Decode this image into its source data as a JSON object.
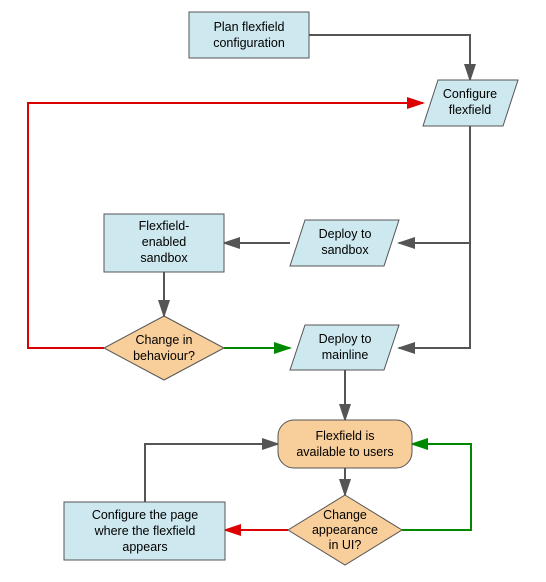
{
  "chart_data": {
    "type": "flowchart",
    "nodes": [
      {
        "id": "plan",
        "type": "process",
        "label_lines": [
          "Plan flexfield",
          "configuration"
        ]
      },
      {
        "id": "configure",
        "type": "io",
        "label_lines": [
          "Configure",
          "flexfield"
        ]
      },
      {
        "id": "deploy_sb",
        "type": "io",
        "label_lines": [
          "Deploy to",
          "sandbox"
        ]
      },
      {
        "id": "sandbox",
        "type": "process",
        "label_lines": [
          "Flexfield-",
          "enabled",
          "sandbox"
        ]
      },
      {
        "id": "decision1",
        "type": "decision",
        "label_lines": [
          "Change in",
          "behaviour?"
        ]
      },
      {
        "id": "deploy_ml",
        "type": "io",
        "label_lines": [
          "Deploy to",
          "mainline"
        ]
      },
      {
        "id": "available",
        "type": "terminator",
        "label_lines": [
          "Flexfield is",
          "available to users"
        ]
      },
      {
        "id": "decision2",
        "type": "decision",
        "label_lines": [
          "Change",
          "appearance",
          "in UI?"
        ]
      },
      {
        "id": "config_page",
        "type": "process",
        "label_lines": [
          "Configure the page",
          "where the flexfield",
          "appears"
        ]
      }
    ],
    "edges": [
      {
        "from": "plan",
        "to": "configure",
        "color": "gray"
      },
      {
        "from": "configure",
        "to": "deploy_sb",
        "color": "gray"
      },
      {
        "from": "deploy_sb",
        "to": "sandbox",
        "color": "gray"
      },
      {
        "from": "sandbox",
        "to": "decision1",
        "color": "gray"
      },
      {
        "from": "decision1",
        "to": "configure",
        "color": "red",
        "meaning": "yes"
      },
      {
        "from": "decision1",
        "to": "deploy_ml",
        "color": "green",
        "meaning": "no"
      },
      {
        "from": "configure",
        "to": "deploy_ml",
        "color": "gray"
      },
      {
        "from": "deploy_ml",
        "to": "available",
        "color": "gray"
      },
      {
        "from": "available",
        "to": "decision2",
        "color": "gray"
      },
      {
        "from": "decision2",
        "to": "config_page",
        "color": "red",
        "meaning": "yes"
      },
      {
        "from": "decision2",
        "to": "available",
        "color": "green",
        "meaning": "no"
      },
      {
        "from": "config_page",
        "to": "available",
        "color": "gray"
      }
    ]
  },
  "colors": {
    "process_fill": "#cde8ee",
    "terminator_fill": "#f8ce9a",
    "decision_fill": "#f8ce9a",
    "io_fill": "#cde8ee",
    "stroke": "#555555",
    "arrow_red": "#d00000",
    "arrow_green": "#008000"
  }
}
